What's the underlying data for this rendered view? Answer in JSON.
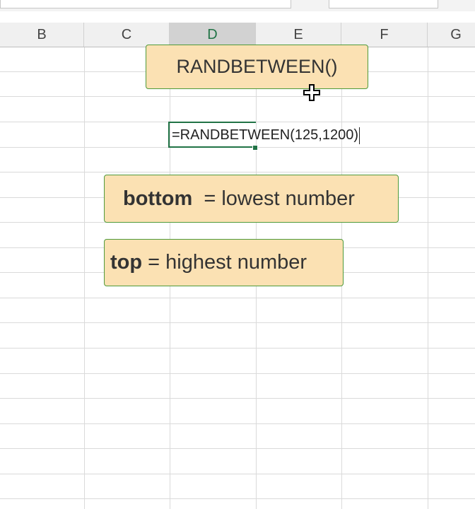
{
  "columns": [
    {
      "label": "B",
      "selected": false
    },
    {
      "label": "C",
      "selected": false
    },
    {
      "label": "D",
      "selected": true
    },
    {
      "label": "E",
      "selected": false
    },
    {
      "label": "F",
      "selected": false
    },
    {
      "label": "G",
      "selected": false
    }
  ],
  "cell": {
    "formula": "=RANDBETWEEN(125,1200)"
  },
  "callouts": {
    "title": "RANDBETWEEN()",
    "bottom_keyword": "bottom",
    "bottom_text": "  = lowest number",
    "top_keyword": "top",
    "top_text": " = highest number"
  },
  "icons": {
    "cursor": "move-cursor-icon"
  },
  "colors": {
    "accent": "#217346",
    "callout_fill": "#fbe1b3",
    "callout_border": "#4f9a3a"
  }
}
